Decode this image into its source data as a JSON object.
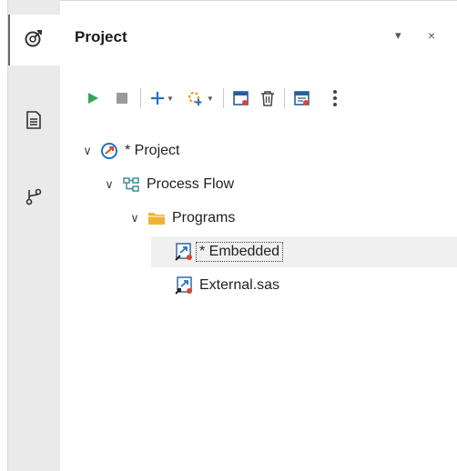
{
  "panel": {
    "title": "Project",
    "menu_glyph": "▾",
    "close_glyph": "×"
  },
  "activity_bar": [
    {
      "icon": "projects-icon",
      "active": true
    },
    {
      "icon": "document-icon",
      "active": false
    },
    {
      "icon": "branch-icon",
      "active": false
    }
  ],
  "toolbar": [
    {
      "icon": "run-icon",
      "color": "#3aa35a"
    },
    {
      "icon": "stop-icon",
      "color": "#9a9a9a"
    },
    {
      "icon": "add-icon",
      "color": "#1e73c9",
      "dropdown": true
    },
    {
      "icon": "add-items-icon",
      "color": "#e39a1b",
      "dropdown": true
    },
    {
      "icon": "open-icon"
    },
    {
      "icon": "delete-icon"
    },
    {
      "icon": "properties-icon"
    },
    {
      "icon": "more-icon"
    }
  ],
  "tree": [
    {
      "label": "* Project",
      "icon": "project-icon",
      "level": 0,
      "expanded": true
    },
    {
      "label": "Process Flow",
      "icon": "process-flow-icon",
      "level": 1,
      "expanded": true
    },
    {
      "label": "Programs",
      "icon": "folder-icon",
      "level": 2,
      "expanded": true
    },
    {
      "label": "* Embedded",
      "icon": "sas-program-icon",
      "level": 3,
      "selected": true
    },
    {
      "label": "External.sas",
      "icon": "sas-program-link-icon",
      "level": 3
    }
  ],
  "colors": {
    "accent_blue": "#1e73c9",
    "folder_orange": "#f2b233",
    "run_green": "#3aa35a",
    "error_red": "#e0452b"
  }
}
